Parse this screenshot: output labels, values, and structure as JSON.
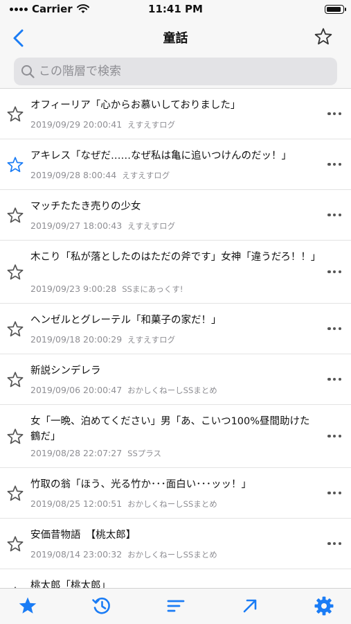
{
  "status": {
    "carrier": "Carrier",
    "time": "11:41 PM"
  },
  "nav": {
    "title": "童話"
  },
  "search": {
    "placeholder": "この階層で検索"
  },
  "colors": {
    "accent": "#1a7cf5",
    "secondary_text": "#8e8e93"
  },
  "items": [
    {
      "title": "オフィーリア「心からお慕いしておりました」",
      "date": "2019/09/29 20:00:41",
      "source": "えすえすログ",
      "favorited": false
    },
    {
      "title": "アキレス「なぜだ……なぜ私は亀に追いつけんのだッ！」",
      "date": "2019/09/28 8:00:44",
      "source": "えすえすログ",
      "favorited": true
    },
    {
      "title": "マッチたたき売りの少女",
      "date": "2019/09/27 18:00:43",
      "source": "えすえすログ",
      "favorited": false
    },
    {
      "title": "木こり「私が落としたのはただの斧です」女神「違うだろ！！」",
      "date": "2019/09/23 9:00:28",
      "source": "SSまにあっくす!",
      "favorited": false
    },
    {
      "title": "ヘンゼルとグレーテル「和菓子の家だ！」",
      "date": "2019/09/18 20:00:29",
      "source": "えすえすログ",
      "favorited": false
    },
    {
      "title": "新説シンデレラ",
      "date": "2019/09/06 20:00:47",
      "source": "おかしくねーしSSまとめ",
      "favorited": false
    },
    {
      "title": "女「一晩、泊めてください」男「あ、こいつ100%昼間助けた鶴だ」",
      "date": "2019/08/28 22:07:27",
      "source": "SSプラス",
      "favorited": false
    },
    {
      "title": "竹取の翁「ほう、光る竹か･･･面白い･･･ッッ！」",
      "date": "2019/08/25 12:00:51",
      "source": "おかしくねーしSSまとめ",
      "favorited": false
    },
    {
      "title": "安価昔物語　【桃太郎】",
      "date": "2019/08/14 23:00:32",
      "source": "おかしくねーしSSまとめ",
      "favorited": false
    },
    {
      "title": "桃太郎「桃太郎」",
      "date": "",
      "source": "",
      "favorited": false
    }
  ],
  "tabs": [
    {
      "icon": "star-filled-icon",
      "name": "tab-favorites"
    },
    {
      "icon": "history-icon",
      "name": "tab-history"
    },
    {
      "icon": "sort-icon",
      "name": "tab-sort"
    },
    {
      "icon": "arrow-up-right-icon",
      "name": "tab-jump"
    },
    {
      "icon": "gear-icon",
      "name": "tab-settings"
    }
  ]
}
